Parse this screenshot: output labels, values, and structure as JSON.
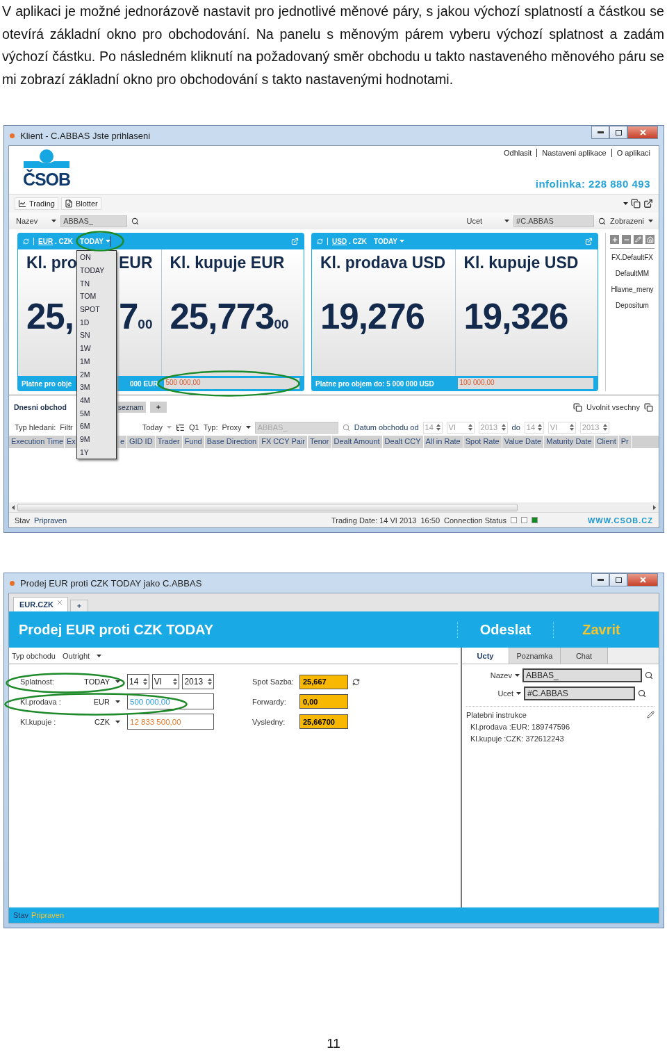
{
  "intro": "V aplikaci je možné jednorázově nastavit pro jednotlivé měnové páry, s jakou výchozí splatností a částkou se otevírá základní okno pro obchodování. Na panelu s měnovým párem vyberu výchozí splatnost a zadám výchozí částku. Po následném kliknutí na požadovaný směr obchodu u takto nastaveného měnového páru se mi zobrazí základní okno pro obchodování s takto nastavenými hodnotami.",
  "client_window": {
    "title": "Klient - C.ABBAS Jste prihlaseni",
    "logo": "ČSOB",
    "top_links": [
      "Odhlasit",
      "Nastaveni aplikace",
      "O aplikaci"
    ],
    "hotline": "infolinka: 228 880 493",
    "toolbar_tabs": [
      {
        "label": "Trading",
        "kind": "chart"
      },
      {
        "label": "Blotter",
        "kind": "search"
      }
    ],
    "filter": {
      "name_label": "Nazev",
      "name_value": "ABBAS_",
      "account_label": "Ucet",
      "account_value": "#C.ABBAS",
      "view": "Zobrazeni"
    },
    "tiles": [
      {
        "base": "EUR",
        "rest": ". CZK",
        "tenor": "TODAY",
        "tenor_open": true,
        "sell_label": [
          "Kl. pro",
          "EUR"
        ],
        "sell_rate": [
          "25,",
          "7"
        ],
        "sell_small": "00",
        "buy_label": "Kl. kupuje EUR",
        "buy_rate": "25,773",
        "buy_small": "00",
        "footer": [
          "Platne pro obje",
          "000 EUR"
        ],
        "amount": "500 000,00"
      },
      {
        "base": "USD",
        "rest": ". CZK",
        "tenor": "TODAY",
        "tenor_open": false,
        "sell_label": [
          "Kl. prodava USD"
        ],
        "sell_rate": [
          "19,276"
        ],
        "buy_label": "Kl. kupuje USD",
        "buy_rate": "19,326",
        "footer": [
          "Platne pro objem do: 5 000 000 USD"
        ],
        "amount": "100 000,00"
      }
    ],
    "profiles": [
      "FX.DefaultFX",
      "DefaultMM",
      "Hlavne_meny",
      "Depositum"
    ],
    "tenor_menu": [
      "ON",
      "TODAY",
      "TN",
      "TOM",
      "SPOT",
      "1D",
      "SN",
      "1W",
      "1M",
      "2M",
      "3M",
      "4M",
      "5M",
      "6M",
      "9M",
      "1Y"
    ],
    "blotter": {
      "tabs": [
        {
          "label": "Dnesni obchod",
          "selected": true
        },
        {
          "label": "seznam",
          "selected": false
        }
      ],
      "release_all": "Uvolnit vsechny",
      "search_type_label": "Typ hledani:",
      "search_type": "Filtr",
      "period": "Today",
      "query": "Q1",
      "type_label": "Typ:",
      "type": "Proxy",
      "name": "ABBAS_",
      "date_label": "Datum obchodu od",
      "date_from": [
        "14",
        "VI",
        "2013"
      ],
      "to_label": "do",
      "date_to": [
        "14",
        "VI",
        "2013"
      ],
      "columns": [
        "Execution Time",
        "Ex",
        "e",
        "GID ID",
        "Trader",
        "Fund",
        "Base Direction",
        "FX CCY Pair",
        "Tenor",
        "Dealt Amount",
        "Dealt CCY",
        "All in Rate",
        "Spot Rate",
        "Value Date",
        "Maturity Date",
        "Client",
        "Pr"
      ]
    },
    "status": {
      "label": "Stav",
      "value": "Pripraven",
      "trading_date": "Trading Date: 14 VI 2013",
      "time": "16:50",
      "connection_label": "Connection Status",
      "lights": [
        {
          "on": false
        },
        {
          "on": false
        },
        {
          "on": true
        }
      ],
      "website": "WWW.CSOB.CZ"
    }
  },
  "deal_window": {
    "title": "Prodej EUR proti CZK TODAY jako C.ABBAS",
    "tabs": [
      {
        "label": "EUR.CZK",
        "selected": true
      }
    ],
    "heading": "Prodej EUR proti CZK TODAY",
    "send": "Odeslat",
    "close": "Zavrit",
    "trade_type_label": "Typ obchodu",
    "trade_type": "Outright",
    "settlement_label": "Splatnost:",
    "settlement": "TODAY",
    "settlement_date": [
      "14",
      "VI",
      "2013"
    ],
    "legs": [
      {
        "label": "Kl.prodava :",
        "currency": "EUR",
        "amount": "500 000,00"
      },
      {
        "label": "Kl.kupuje :",
        "currency": "CZK",
        "amount": "12 833 500,00"
      }
    ],
    "rates": [
      {
        "label": "Spot Sazba:",
        "value": "25,667"
      },
      {
        "label": "Forwardy:",
        "value": "0,00"
      },
      {
        "label": "Vysledny:",
        "value": "25,66700"
      }
    ],
    "side_tabs": [
      {
        "label": "Ucty",
        "selected": true
      },
      {
        "label": "Poznamka",
        "selected": false
      },
      {
        "label": "Chat",
        "selected": false
      }
    ],
    "name_label": "Nazev",
    "name_value": "ABBAS_",
    "account_label": "Ucet",
    "account_value": "#C.ABBAS",
    "instructions_title": "Platebni instrukce",
    "instructions": [
      "Kl.prodava :EUR: 189747596",
      "Kl.kupuje :CZK: 372612243"
    ],
    "status_label": "Stav",
    "status_value": "Pripraven"
  },
  "page_number": "11"
}
